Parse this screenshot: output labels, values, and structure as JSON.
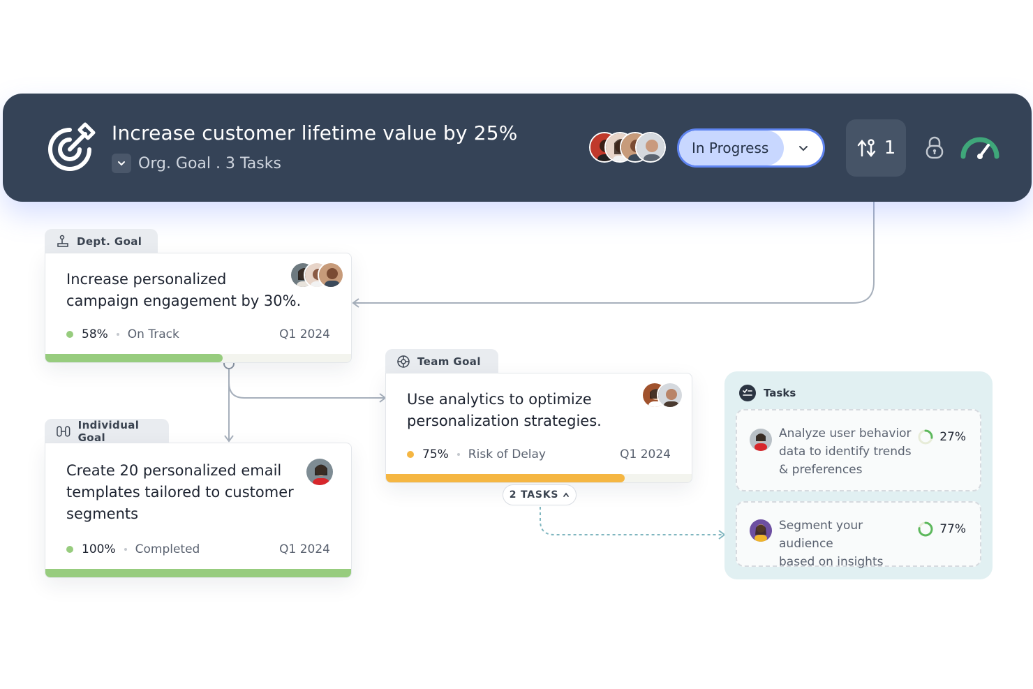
{
  "header": {
    "title": "Increase customer lifetime value by 25%",
    "subtitle": "Org. Goal . 3 Tasks",
    "status": "In Progress",
    "dependencies_count": "1",
    "colors": {
      "background": "#354357",
      "status_border": "#5f84f0",
      "status_fill": "#c8d7ff",
      "gauge": "#3fa77a"
    }
  },
  "dept_goal": {
    "tab_label": "Dept. Goal",
    "title_line1": "Increase personalized",
    "title_line2": "campaign engagement by 30%.",
    "percent": "58%",
    "status": "On Track",
    "quarter": "Q1 2024",
    "progress": 0.58,
    "color": "#97cc7e"
  },
  "individual_goal": {
    "tab_label": "Individual Goal",
    "title_line1": "Create 20 personalized email",
    "title_line2": "templates tailored to customer",
    "title_line3": "segments",
    "percent": "100%",
    "status": "Completed",
    "quarter": "Q1 2024",
    "progress": 1.0,
    "color": "#97cc7e"
  },
  "team_goal": {
    "tab_label": "Team Goal",
    "title_line1": "Use analytics to optimize",
    "title_line2": "personalization strategies.",
    "percent": "75%",
    "status": "Risk of Delay",
    "quarter": "Q1 2024",
    "progress": 0.78,
    "color": "#f5b642",
    "tasks_toggle": "2 TASKS"
  },
  "tasks_panel": {
    "title": "Tasks",
    "items": [
      {
        "line1": "Analyze user behavior",
        "line2": "data to identify trends",
        "line3": "& preferences",
        "percent": "27%",
        "progress": 0.27
      },
      {
        "line1": "Segment your audience",
        "line2": "based on insights",
        "percent": "77%",
        "progress": 0.77
      }
    ]
  }
}
